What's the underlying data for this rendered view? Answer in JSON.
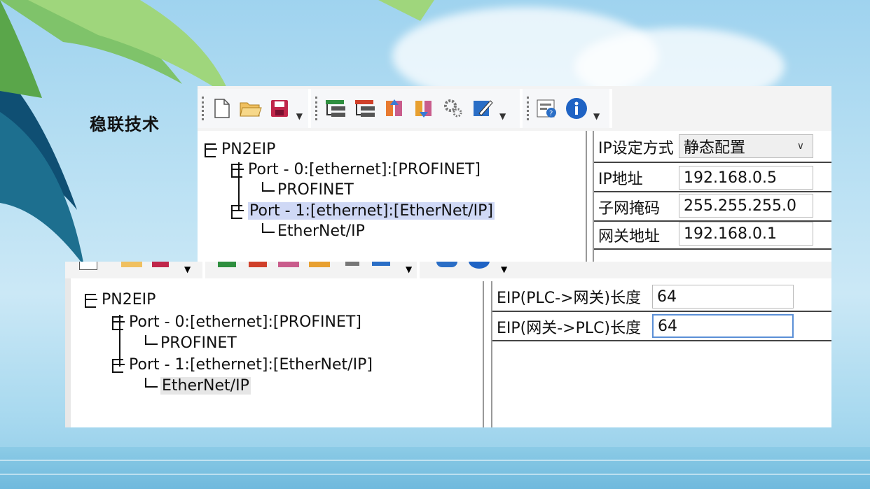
{
  "brand": {
    "title": "稳联技术"
  },
  "top_window": {
    "toolbar": {
      "icons": [
        "new-file-icon",
        "open-folder-icon",
        "save-icon",
        "add-node-icon",
        "remove-node-icon",
        "upload-icon",
        "download-icon",
        "settings-icon",
        "edit-icon",
        "help-icon",
        "info-icon"
      ]
    },
    "tree": {
      "root": "PN2EIP",
      "port0": "Port - 0:[ethernet]:[PROFINET]",
      "port0_child": "PROFINET",
      "port1": "Port - 1:[ethernet]:[EtherNet/IP]",
      "port1_child": "EtherNet/IP"
    },
    "properties": {
      "ip_mode_label": "IP设定方式",
      "ip_mode_value": "静态配置",
      "ip_label": "IP地址",
      "ip_value": "192.168.0.5",
      "mask_label": "子网掩码",
      "mask_value": "255.255.255.0",
      "gateway_label": "网关地址",
      "gateway_value": "192.168.0.1"
    }
  },
  "bottom_window": {
    "tree": {
      "root": "PN2EIP",
      "port0": "Port - 0:[ethernet]:[PROFINET]",
      "port0_child": "PROFINET",
      "port1": "Port - 1:[ethernet]:[EtherNet/IP]",
      "port1_child": "EtherNet/IP"
    },
    "properties": {
      "plc_to_gw_label": "EIP(PLC->网关)长度",
      "plc_to_gw_value": "64",
      "gw_to_plc_label": "EIP(网关->PLC)长度",
      "gw_to_plc_value": "64"
    }
  }
}
